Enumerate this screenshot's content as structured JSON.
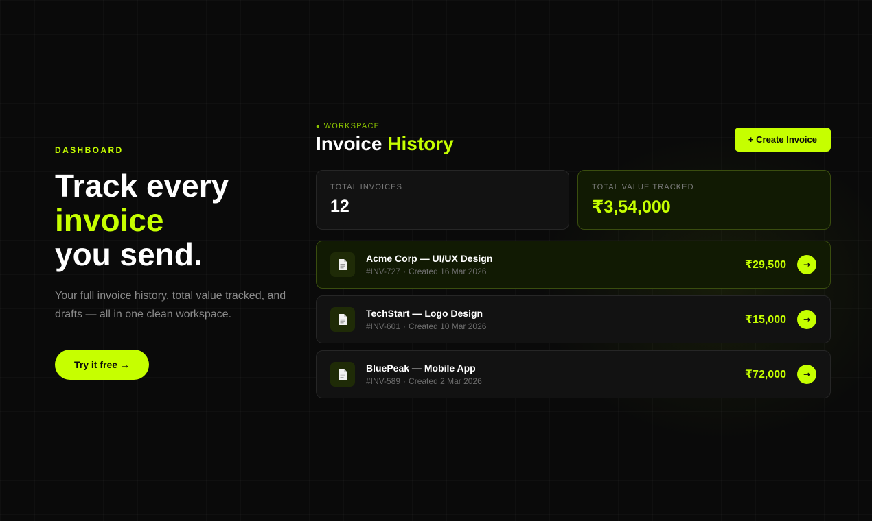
{
  "hero": {
    "eyebrow": "DASHBOARD",
    "headline_1": "Track every",
    "headline_accent": "invoice",
    "headline_2": "you send.",
    "subtitle": "Your full invoice history, total value tracked, and drafts — all in one clean workspace.",
    "cta_label": "Try it free",
    "cta_arrow": "→"
  },
  "panel": {
    "workspace_dot": "●",
    "workspace_label": "WORKSPACE",
    "title_main": "Invoice",
    "title_accent": "History",
    "create_label": "+ Create Invoice"
  },
  "stats": [
    {
      "label": "TOTAL INVOICES",
      "value": "12"
    },
    {
      "label": "TOTAL VALUE TRACKED",
      "value": "₹3,54,000"
    }
  ],
  "invoices": [
    {
      "title": "Acme Corp — UI/UX Design",
      "id": "#INV-727",
      "sep": "·",
      "created": "Created 16 Mar 2026",
      "amount": "₹29,500",
      "icon": "document-icon",
      "go": "→"
    },
    {
      "title": "TechStart — Logo Design",
      "id": "#INV-601",
      "sep": "·",
      "created": "Created 10 Mar 2026",
      "amount": "₹15,000",
      "icon": "document-icon",
      "go": "→"
    },
    {
      "title": "BluePeak — Mobile App",
      "id": "#INV-589",
      "sep": "·",
      "created": "Created 2 Mar 2026",
      "amount": "₹72,000",
      "icon": "document-icon",
      "go": "→"
    }
  ],
  "colors": {
    "accent": "#c6ff00",
    "background": "#0a0a0a",
    "card": "#121212",
    "muted": "#8a8a8a"
  }
}
